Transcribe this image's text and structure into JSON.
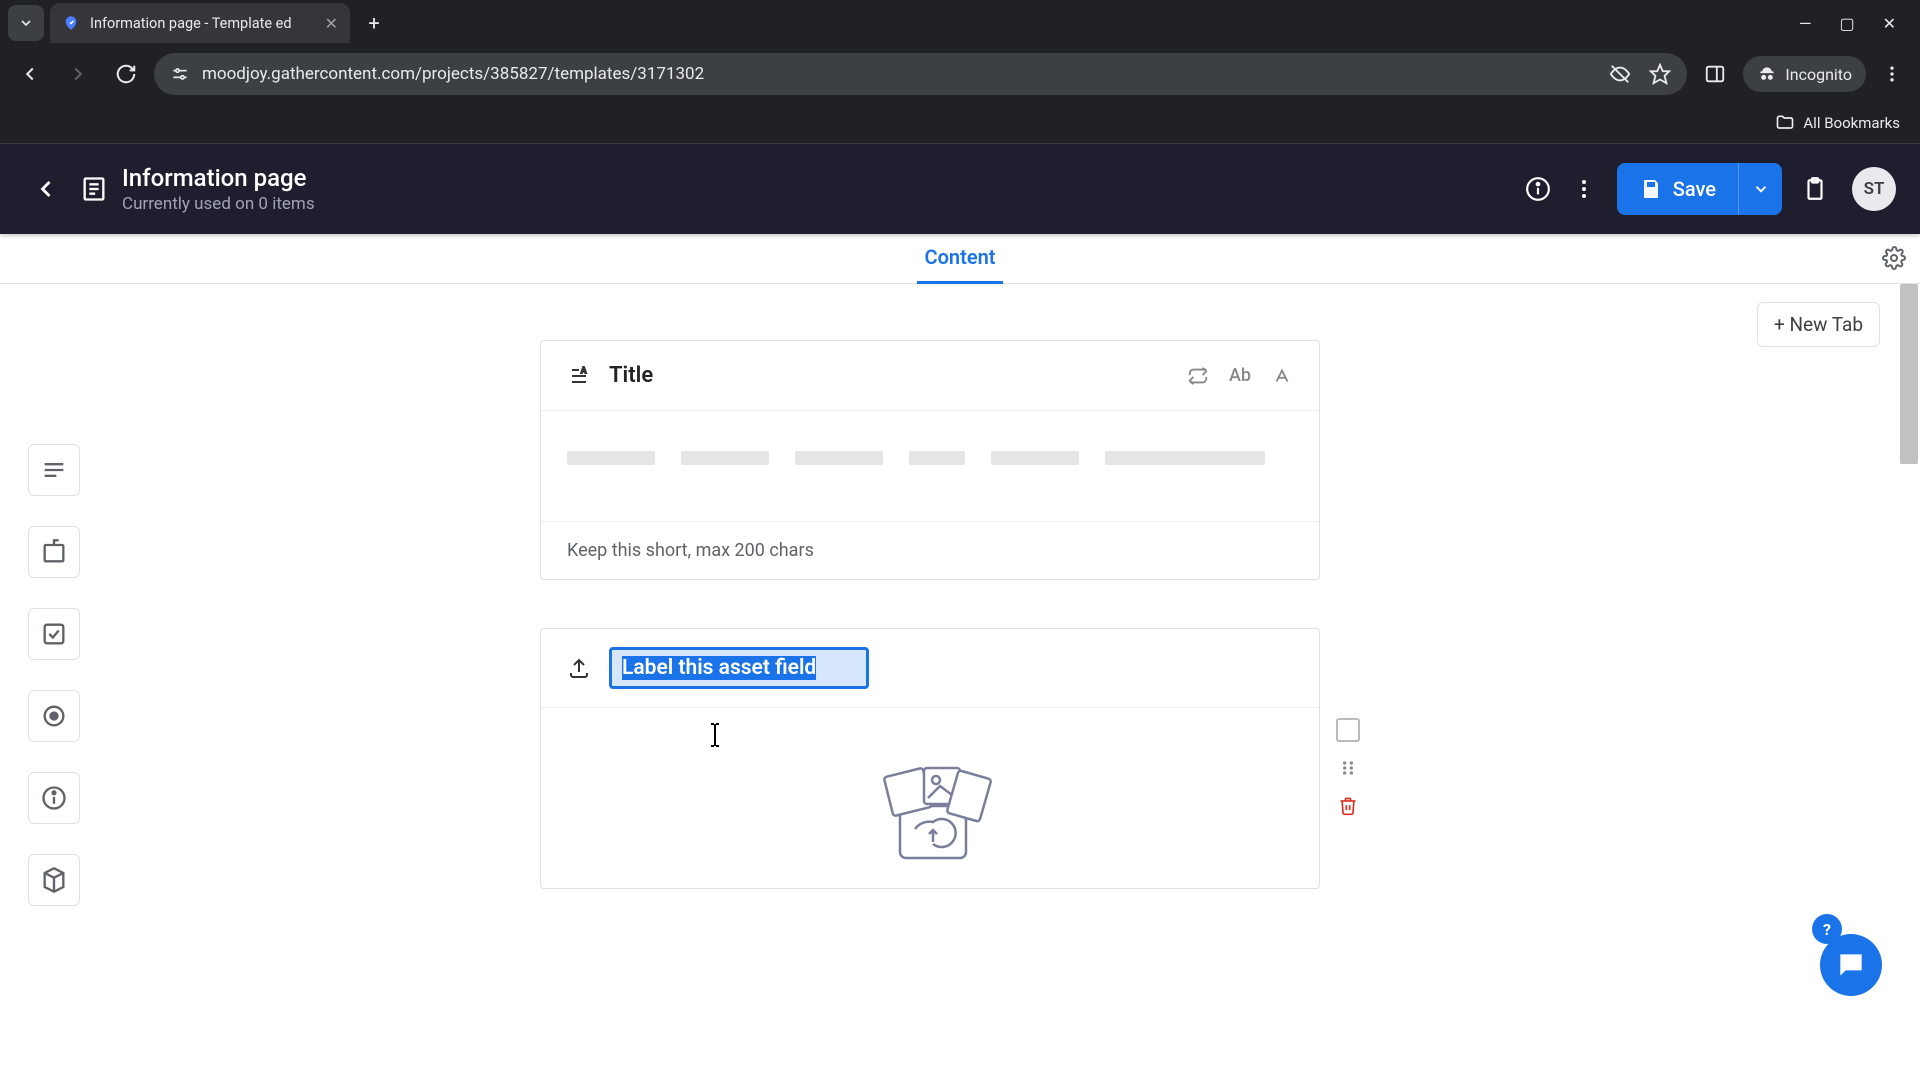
{
  "browser": {
    "tab_title": "Information page - Template ed",
    "url": "moodjoy.gathercontent.com/projects/385827/templates/3171302",
    "incognito_label": "Incognito",
    "bookmarks_label": "All Bookmarks"
  },
  "header": {
    "title": "Information page",
    "subtitle": "Currently used on 0 items",
    "save_label": "Save",
    "avatar_initials": "ST"
  },
  "tabs": {
    "active": "Content",
    "new_tab_label": "+ New Tab"
  },
  "fields": {
    "title_field": {
      "label": "Title",
      "hint": "Keep this short, max 200 chars",
      "skeleton_widths": [
        88,
        88,
        88,
        56,
        88,
        160
      ]
    },
    "asset_field": {
      "placeholder": "Label this asset field",
      "value": "Label this asset field"
    }
  },
  "icons": {
    "rail": [
      "text-block",
      "component",
      "checkbox",
      "radio",
      "info",
      "cube"
    ]
  }
}
